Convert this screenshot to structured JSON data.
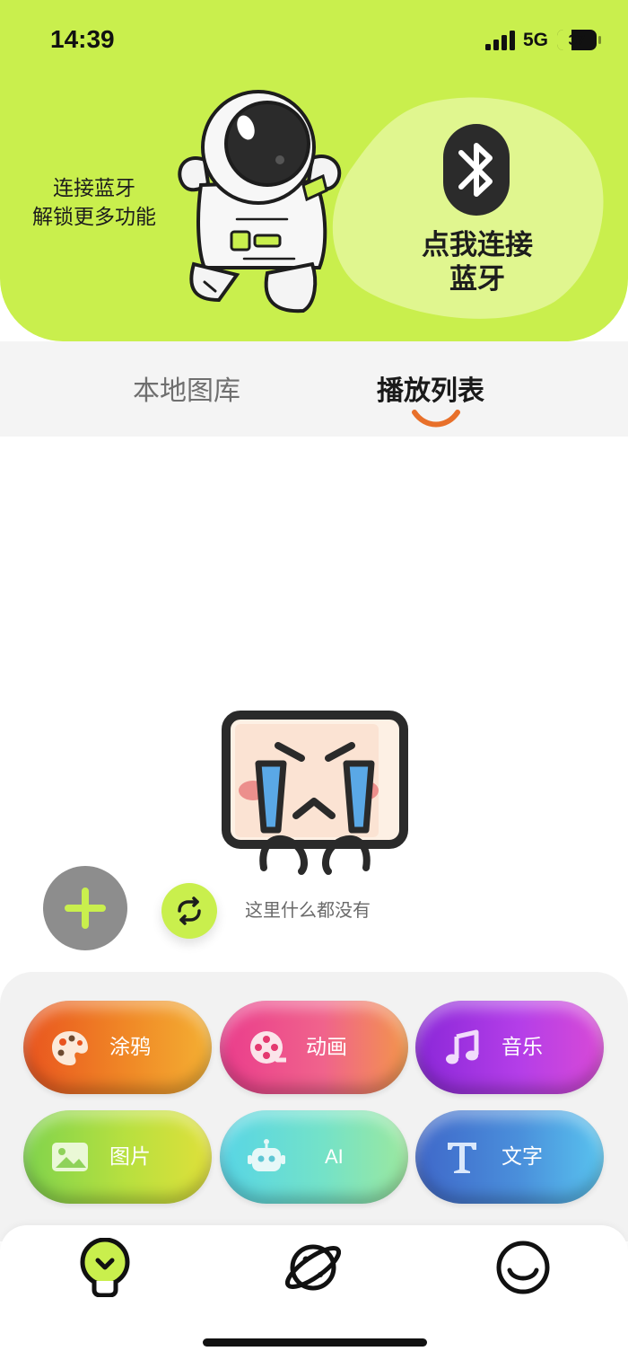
{
  "status_bar": {
    "time": "14:39",
    "network": "5G",
    "battery_level": "37",
    "battery_fraction": 0.37
  },
  "header": {
    "promo_line1": "连接蓝牙",
    "promo_line2": "解锁更多功能",
    "bluetooth_line1": "点我连接",
    "bluetooth_line2": "蓝牙",
    "accent_color": "#c9ef4d"
  },
  "tabs": [
    {
      "label": "本地图库",
      "active": false
    },
    {
      "label": "播放列表",
      "active": true
    }
  ],
  "tab_indicator_color": "#e8702a",
  "empty_state": {
    "message": "这里什么都没有"
  },
  "features": [
    {
      "label": "涂鸦",
      "icon": "palette-icon"
    },
    {
      "label": "动画",
      "icon": "film-reel-icon"
    },
    {
      "label": "音乐",
      "icon": "music-note-icon"
    },
    {
      "label": "图片",
      "icon": "image-icon"
    },
    {
      "label": "AI",
      "icon": "robot-icon"
    },
    {
      "label": "文字",
      "icon": "text-t-icon"
    }
  ],
  "bottom_nav": [
    {
      "name": "home",
      "icon": "lightbulb-icon",
      "active": true
    },
    {
      "name": "discover",
      "icon": "planet-icon",
      "active": false
    },
    {
      "name": "profile",
      "icon": "smile-icon",
      "active": false
    }
  ]
}
